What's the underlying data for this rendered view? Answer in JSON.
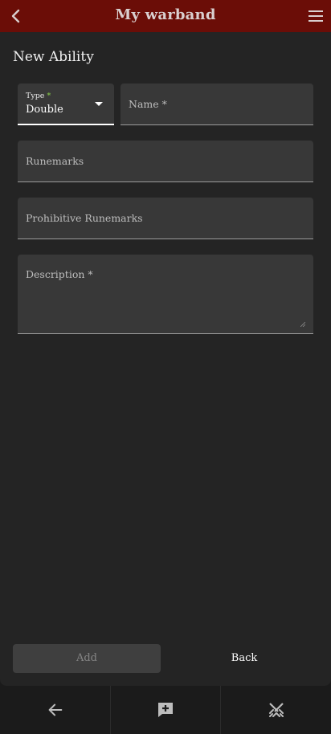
{
  "appbar": {
    "title": "My warband",
    "back_icon": "chevron-left-icon",
    "menu_icon": "hamburger-menu-icon",
    "color": "#6b0d07"
  },
  "form": {
    "heading": "New Ability",
    "type": {
      "label": "Type",
      "required_mark": "*",
      "value": "Double"
    },
    "name": {
      "label": "Name",
      "required_mark": "*",
      "value": ""
    },
    "runemarks": {
      "label": "Runemarks",
      "value": ""
    },
    "prohibitive_runemarks": {
      "label": "Prohibitive Runemarks",
      "value": ""
    },
    "description": {
      "label": "Description",
      "required_mark": "*",
      "value": ""
    }
  },
  "actions": {
    "add_label": "Add",
    "back_label": "Back"
  },
  "bottom_nav": [
    {
      "icon": "arrow-left-icon"
    },
    {
      "icon": "comment-plus-icon"
    },
    {
      "icon": "crossed-swords-icon"
    }
  ]
}
